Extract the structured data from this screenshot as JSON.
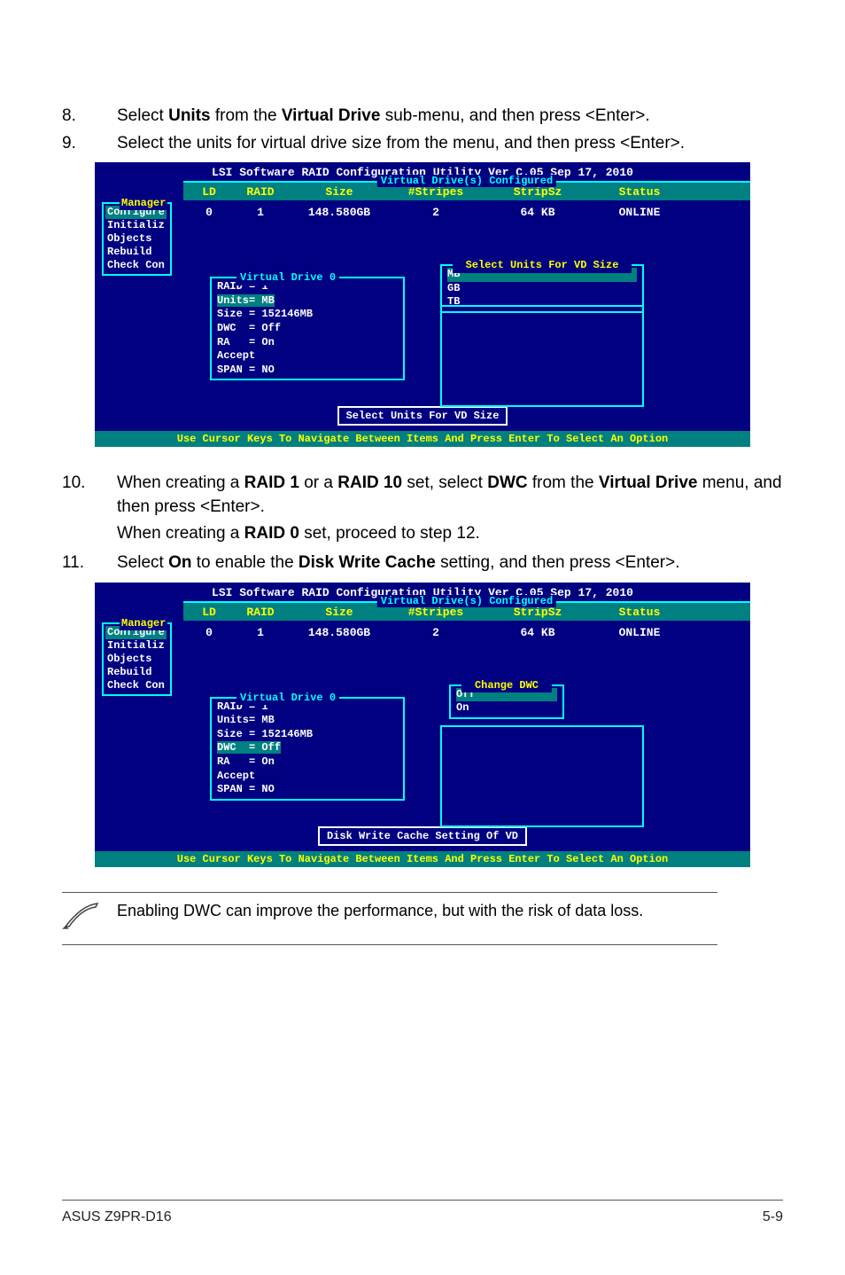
{
  "steps": {
    "s8": {
      "num": "8.",
      "body_parts": [
        "Select ",
        "Units",
        " from the ",
        "Virtual Drive",
        " sub-menu, and then press <Enter>."
      ]
    },
    "s9": {
      "num": "9.",
      "body": "Select the units for virtual drive size from the menu, and then press <Enter>."
    },
    "s10": {
      "num": "10.",
      "body_parts": [
        "When creating a ",
        "RAID 1",
        " or a ",
        "RAID 10",
        " set, select ",
        "DWC",
        " from the ",
        "Virtual Drive",
        " menu, and then press <Enter>."
      ]
    },
    "s10b": {
      "parts": [
        "When creating a ",
        "RAID 0",
        " set, proceed to step 12."
      ]
    },
    "s11": {
      "num": "11.",
      "body_parts": [
        "Select ",
        "On",
        " to enable the ",
        "Disk Write Cache",
        " setting, and then press <Enter>."
      ]
    }
  },
  "bios": {
    "title": "LSI Software RAID Configuration Utility Ver C.05 Sep 17, 2010",
    "config_label": "Virtual Drive(s) Configured",
    "headers": {
      "ld": "LD",
      "raid": "RAID",
      "size": "Size",
      "stripes": "#Stripes",
      "stripsz": "StripSz",
      "status": "Status"
    },
    "row": {
      "ld": "0",
      "raid": "1",
      "size": "148.580GB",
      "stripes": "2",
      "stripsz": "64 KB",
      "status": "ONLINE"
    },
    "menu_label": "Manager",
    "menu": [
      "Configure",
      "Initializ",
      "Objects",
      "Rebuild",
      "Check Con"
    ],
    "vd0_label": "Virtual Drive 0",
    "vd0": {
      "raid": "RAID = 1",
      "units": "Units= MB",
      "size": "Size = 152146MB",
      "dwc": "DWC  = Off",
      "ra": "RA   = On",
      "accept": "Accept",
      "span": "SPAN = NO"
    },
    "footer": "Use Cursor Keys To Navigate Between Items And Press Enter To Select An Option"
  },
  "panel1": {
    "select_label": "Select Units For VD Size",
    "select_opts": [
      "MB",
      "GB",
      "TB"
    ],
    "status": "Select Units For VD Size"
  },
  "panel2": {
    "select_label": "Change DWC",
    "select_opts": [
      "Off",
      "On"
    ],
    "status": "Disk Write Cache Setting Of VD"
  },
  "note": "Enabling DWC can improve the performance, but with the risk of data loss.",
  "footer": {
    "left": "ASUS Z9PR-D16",
    "right": "5-9"
  }
}
